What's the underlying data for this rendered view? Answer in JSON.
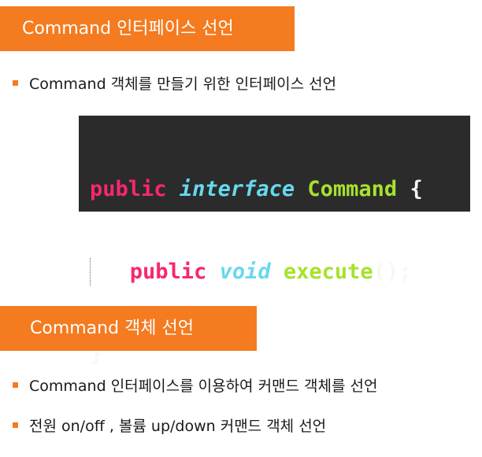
{
  "section1": {
    "title": "Command 인터페이스 선언",
    "bullet": "Command 객체를 만들기 위한 인터페이스 선언"
  },
  "code": {
    "line1": {
      "kw": "public",
      "type": "interface",
      "name": "Command",
      "brace": "{"
    },
    "line2": {
      "kw": "public",
      "type": "void",
      "method": "execute",
      "parens": "();"
    },
    "line3": {
      "brace": "}"
    }
  },
  "section2": {
    "title": "Command 객체 선언",
    "bullets": [
      "Command 인터페이스를 이용하여 커맨드 객체를 선언",
      "전원 on/off , 볼륨 up/down 커맨드 객체 선언"
    ]
  },
  "colors": {
    "accent": "#f47b20",
    "code_bg": "#2b2b2b",
    "keyword": "#f92672",
    "type": "#66d9ef",
    "identifier": "#a6e22e",
    "punctuation": "#f8f8f2"
  }
}
